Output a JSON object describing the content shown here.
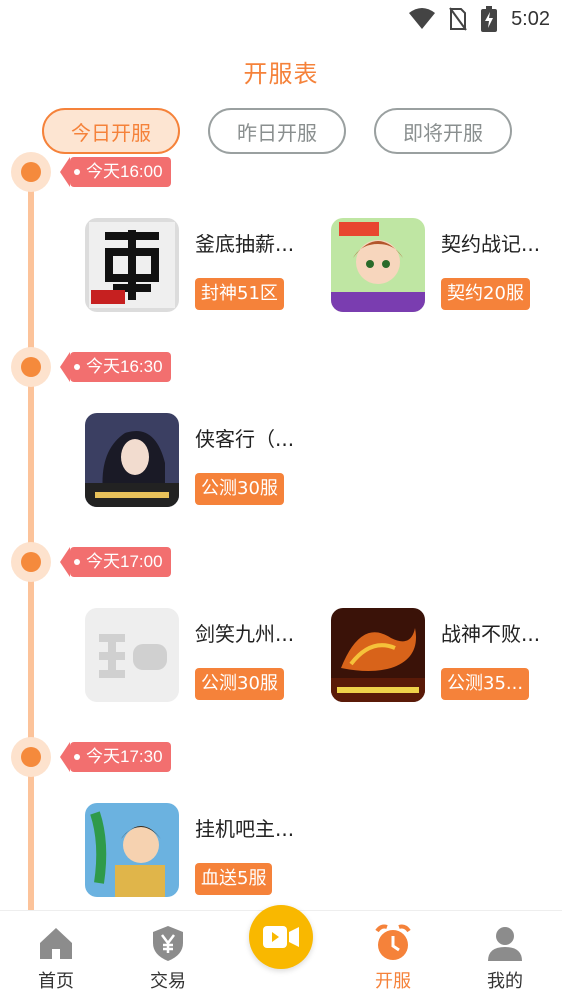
{
  "status": {
    "time": "5:02"
  },
  "header": {
    "title": "开服表"
  },
  "tabs": [
    {
      "label": "今日开服",
      "active": true
    },
    {
      "label": "昨日开服",
      "active": false
    },
    {
      "label": "即将开服",
      "active": false
    }
  ],
  "groups": [
    {
      "time": "今天16:00",
      "games": [
        {
          "name": "釜底抽薪...",
          "badge": "封神51区",
          "icon": "dragon-calligraphy-icon"
        },
        {
          "name": "契约战记...",
          "badge": "契约20服",
          "icon": "anime-girl-icon"
        }
      ]
    },
    {
      "time": "今天16:30",
      "games": [
        {
          "name": "侠客行（...",
          "badge": "公测30服",
          "icon": "swordswoman-icon"
        }
      ]
    },
    {
      "time": "今天17:00",
      "games": [
        {
          "name": "剑笑九州...",
          "badge": "公测30服",
          "icon": "placeholder-play-icon"
        },
        {
          "name": "战神不败...",
          "badge": "公测35...",
          "icon": "fire-dragon-icon"
        }
      ]
    },
    {
      "time": "今天17:30",
      "games": [
        {
          "name": "挂机吧主...",
          "badge": "血送5服",
          "icon": "cartoon-hero-icon"
        }
      ]
    }
  ],
  "nav": [
    {
      "label": "首页",
      "icon": "home-icon"
    },
    {
      "label": "交易",
      "icon": "shield-yen-icon"
    },
    {
      "label": "",
      "icon": "video-camera-icon"
    },
    {
      "label": "开服",
      "icon": "alarm-clock-icon",
      "active": true
    },
    {
      "label": "我的",
      "icon": "user-icon"
    }
  ],
  "colors": {
    "accent": "#f5823a",
    "tag": "#f26f6f",
    "center": "#f9b800"
  }
}
